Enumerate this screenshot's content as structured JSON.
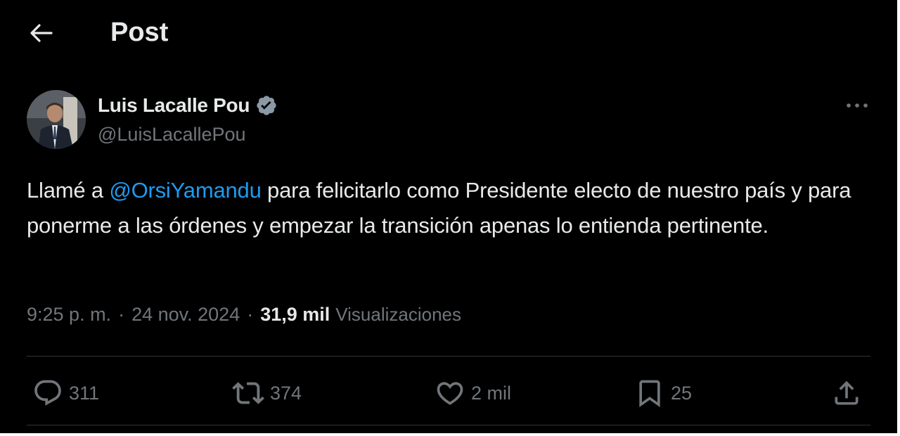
{
  "header": {
    "title": "Post",
    "back_icon": "arrow-left-icon"
  },
  "author": {
    "name": "Luis Lacalle Pou",
    "handle": "@LuisLacallePou",
    "verified": true,
    "verified_color": "#1d9bf0"
  },
  "tweet": {
    "text_before": "Llamé a ",
    "mention": "@OrsiYamandu",
    "text_after": " para felicitarlo como Presidente electo de nuestro país y para ponerme a las órdenes y empezar la transición apenas lo entienda pertinente."
  },
  "meta": {
    "time": "9:25 p. m.",
    "separator": "·",
    "date": "24 nov. 2024",
    "views_count": "31,9 mil",
    "views_label": "Visualizaciones"
  },
  "actions": {
    "replies": "311",
    "reposts": "374",
    "likes": "2 mil",
    "bookmarks": "25"
  },
  "colors": {
    "background": "#000000",
    "text_primary": "#e7e9ea",
    "text_secondary": "#71767b",
    "accent": "#1d9bf0",
    "divider": "#2f3336"
  }
}
